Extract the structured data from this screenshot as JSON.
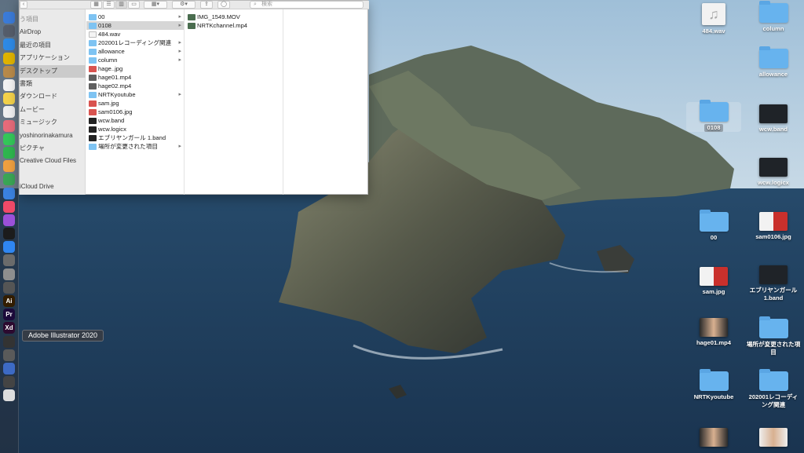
{
  "dock": {
    "tooltip": "Adobe Illustrator 2020",
    "apps": [
      {
        "name": "finder-icon",
        "color": "#3b7bd8",
        "glyph": ""
      },
      {
        "name": "launchpad-icon",
        "color": "#555d6b",
        "glyph": ""
      },
      {
        "name": "safari-icon",
        "color": "#2e8ae6",
        "glyph": ""
      },
      {
        "name": "chrome-icon",
        "color": "#e0b300",
        "glyph": ""
      },
      {
        "name": "contacts-icon",
        "color": "#b88a4a",
        "glyph": ""
      },
      {
        "name": "calendar-icon",
        "color": "#f2f2f2",
        "glyph": ""
      },
      {
        "name": "notes-icon",
        "color": "#f3d24a",
        "glyph": ""
      },
      {
        "name": "reminders-icon",
        "color": "#f0f0f0",
        "glyph": ""
      },
      {
        "name": "photos-icon",
        "color": "#e76b7a",
        "glyph": ""
      },
      {
        "name": "messages-icon",
        "color": "#34c759",
        "glyph": ""
      },
      {
        "name": "facetime-icon",
        "color": "#2fb64f",
        "glyph": ""
      },
      {
        "name": "pages-icon",
        "color": "#f0a040",
        "glyph": ""
      },
      {
        "name": "numbers-icon",
        "color": "#3aa655",
        "glyph": ""
      },
      {
        "name": "keynote-icon",
        "color": "#3b82e0",
        "glyph": ""
      },
      {
        "name": "music-icon",
        "color": "#f04a68",
        "glyph": ""
      },
      {
        "name": "podcasts-icon",
        "color": "#9b50d8",
        "glyph": ""
      },
      {
        "name": "tv-icon",
        "color": "#1c1c1c",
        "glyph": ""
      },
      {
        "name": "app-store-icon",
        "color": "#2f86f2",
        "glyph": ""
      },
      {
        "name": "system-preferences-icon",
        "color": "#6b6b6b",
        "glyph": ""
      },
      {
        "name": "preview-icon",
        "color": "#8e8e8e",
        "glyph": ""
      },
      {
        "name": "creative-cloud-icon",
        "color": "#555",
        "glyph": ""
      },
      {
        "name": "illustrator-icon",
        "color": "#331d00",
        "glyph": "Ai"
      },
      {
        "name": "premiere-icon",
        "color": "#1c0a3a",
        "glyph": "Pr"
      },
      {
        "name": "xd-icon",
        "color": "#2c0a2f",
        "glyph": "Xd"
      },
      {
        "name": "logic-icon",
        "color": "#333",
        "glyph": ""
      },
      {
        "name": "garageband-icon",
        "color": "#5a5a5a",
        "glyph": ""
      },
      {
        "name": "quicktime-icon",
        "color": "#3d6ac4",
        "glyph": ""
      },
      {
        "name": "photo-booth-icon",
        "color": "#444",
        "glyph": ""
      },
      {
        "name": "screenshot-icon",
        "color": "#ddd",
        "glyph": ""
      }
    ]
  },
  "finder": {
    "search_placeholder": "検索",
    "toolbar_glyphs": {
      "icon_view": "▦",
      "list_view": "☰",
      "column_view": "▥",
      "gallery_view": "▭",
      "group": "▦▾",
      "action": "⚙▾",
      "share": "⇪",
      "tag": "◯"
    },
    "sidebar": [
      {
        "label": "う項目",
        "head": true,
        "selected": false
      },
      {
        "label": "AirDrop",
        "head": false,
        "selected": false
      },
      {
        "label": "最近の項目",
        "head": false,
        "selected": false
      },
      {
        "label": "アプリケーション",
        "head": false,
        "selected": false
      },
      {
        "label": "デスクトップ",
        "head": false,
        "selected": true
      },
      {
        "label": "書類",
        "head": false,
        "selected": false
      },
      {
        "label": "ダウンロード",
        "head": false,
        "selected": false
      },
      {
        "label": "ムービー",
        "head": false,
        "selected": false
      },
      {
        "label": "ミュージック",
        "head": false,
        "selected": false
      },
      {
        "label": "yoshinorinakamura",
        "head": false,
        "selected": false
      },
      {
        "label": "ピクチャ",
        "head": false,
        "selected": false
      },
      {
        "label": "Creative Cloud Files",
        "head": false,
        "selected": false
      },
      {
        "label": "",
        "head": true,
        "selected": false
      },
      {
        "label": "iCloud Drive",
        "head": false,
        "selected": false
      }
    ],
    "column1": [
      {
        "label": "00",
        "kind": "folder",
        "chevron": true,
        "selected": false
      },
      {
        "label": "0108",
        "kind": "folder",
        "chevron": true,
        "selected": true
      },
      {
        "label": "484.wav",
        "kind": "file",
        "chevron": false,
        "selected": false
      },
      {
        "label": "202001レコーディング関連",
        "kind": "folder",
        "chevron": true,
        "selected": false
      },
      {
        "label": "allowance",
        "kind": "folder",
        "chevron": true,
        "selected": false
      },
      {
        "label": "column",
        "kind": "folder",
        "chevron": true,
        "selected": false
      },
      {
        "label": "hage..jpg",
        "kind": "img",
        "chevron": false,
        "selected": false
      },
      {
        "label": "hage01.mp4",
        "kind": "media",
        "chevron": false,
        "selected": false
      },
      {
        "label": "hage02.mp4",
        "kind": "media",
        "chevron": false,
        "selected": false
      },
      {
        "label": "NRTKyoutube",
        "kind": "folder",
        "chevron": true,
        "selected": false
      },
      {
        "label": "sam.jpg",
        "kind": "img",
        "chevron": false,
        "selected": false
      },
      {
        "label": "sam0106.jpg",
        "kind": "img",
        "chevron": false,
        "selected": false
      },
      {
        "label": "wcw.band",
        "kind": "band",
        "chevron": false,
        "selected": false
      },
      {
        "label": "wcw.logicx",
        "kind": "band",
        "chevron": false,
        "selected": false
      },
      {
        "label": "エブリヤンガール 1.band",
        "kind": "band",
        "chevron": false,
        "selected": false
      },
      {
        "label": "場所が変更された項目",
        "kind": "folder",
        "chevron": true,
        "selected": false
      }
    ],
    "column2": [
      {
        "label": "IMG_1549.MOV",
        "kind": "movie"
      },
      {
        "label": "NRTKchannel.mp4",
        "kind": "movie"
      }
    ]
  },
  "desktop": {
    "left_column": [
      {
        "label": "484.wav",
        "kind": "audio",
        "glyph": "♫"
      },
      {
        "label": "0108",
        "kind": "folder-selected"
      },
      {
        "label": "00",
        "kind": "folder"
      },
      {
        "label": "sam.jpg",
        "kind": "image-red"
      },
      {
        "label": "hage01.mp4",
        "kind": "video"
      },
      {
        "label": "NRTKyoutube",
        "kind": "folder"
      },
      {
        "label": "",
        "kind": "video"
      }
    ],
    "right_column": [
      {
        "label": "column",
        "kind": "folder"
      },
      {
        "label": "allowance",
        "kind": "folder"
      },
      {
        "label": "wcw.band",
        "kind": "dark"
      },
      {
        "label": "wcw.logicx",
        "kind": "dark"
      },
      {
        "label": "sam0106.jpg",
        "kind": "image-red"
      },
      {
        "label": "エブリヤンガール 1.band",
        "kind": "dark"
      },
      {
        "label": "場所が変更された項目",
        "kind": "folder"
      },
      {
        "label": "202001レコーディング関連",
        "kind": "folder"
      },
      {
        "label": "",
        "kind": "image-light"
      }
    ]
  }
}
